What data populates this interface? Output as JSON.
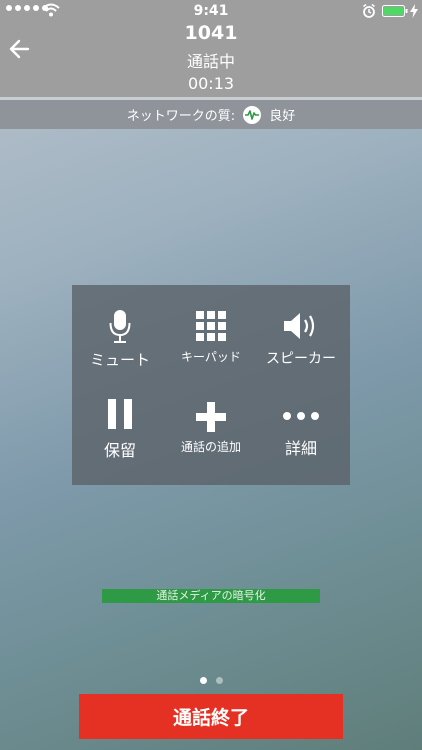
{
  "status_bar": {
    "time": "9:41"
  },
  "call": {
    "number": "1041",
    "status": "通話中",
    "timer": "00:13"
  },
  "network": {
    "label": "ネットワークの質:",
    "quality": "良好",
    "quality_color": "#2e9a45"
  },
  "controls": {
    "mute": "ミュート",
    "keypad": "キーパッド",
    "speaker": "スピーカー",
    "hold": "保留",
    "add_call": "通話の追加",
    "details": "詳細"
  },
  "encryption": {
    "label": "通話メディアの暗号化"
  },
  "pager": {
    "current": 1,
    "total": 2
  },
  "end_call": {
    "label": "通話終了",
    "color": "#e53124"
  }
}
